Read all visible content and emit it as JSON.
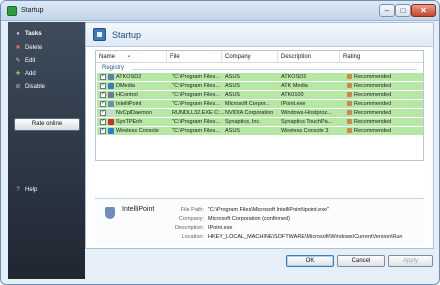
{
  "window": {
    "title": "Startup"
  },
  "sidebar": {
    "items": [
      {
        "label": "Tasks",
        "icon": "bullet-icon"
      },
      {
        "label": "Delete",
        "icon": "delete-icon"
      },
      {
        "label": "Edit",
        "icon": "edit-icon"
      },
      {
        "label": "Add",
        "icon": "add-icon"
      },
      {
        "label": "Disable",
        "icon": "disable-icon"
      }
    ],
    "rate_button": "Rate online",
    "help": "Help"
  },
  "main": {
    "title": "Startup",
    "columns": [
      "Name",
      "File",
      "Company",
      "Description",
      "Rating"
    ],
    "group": "Registry",
    "rows": [
      {
        "name": "ATKOSD2",
        "file": "\"C:\\Program Files...",
        "company": "ASUS",
        "description": "ATKOSD2",
        "rating": "Recommended",
        "color": "#5c7ea6"
      },
      {
        "name": "DMedia",
        "file": "\"C:\\Program Files...",
        "company": "ASUS",
        "description": "ATK Media",
        "rating": "Recommended",
        "color": "#3f7ab8"
      },
      {
        "name": "HControl",
        "file": "\"C:\\Program Files...",
        "company": "ASUS",
        "description": "ATK0100",
        "rating": "Recommended",
        "color": "#6a7c90"
      },
      {
        "name": "IntelliPoint",
        "file": "\"C:\\Program Files...",
        "company": "Microsoft Corpor...",
        "description": "IPoint.exe",
        "rating": "Recommended",
        "color": "#6b8fb8"
      },
      {
        "name": "NvCplDaemon",
        "file": "RUNDLL32.EXE C:...",
        "company": "NVIDIA Corporation",
        "description": "Windows-Hostproz...",
        "rating": "Recommended",
        "color": "#d0d4d8"
      },
      {
        "name": "SynTPEnh",
        "file": "\"C:\\Program Files...",
        "company": "Synaptics, Inc.",
        "description": "Synaptics TouchPa...",
        "rating": "Recommended",
        "color": "#c9302c"
      },
      {
        "name": "Wireless Console",
        "file": "\"C:\\Program Files...",
        "company": "ASUS",
        "description": "Wireless Console 3",
        "rating": "Recommended",
        "color": "#2a7fd0"
      }
    ]
  },
  "details": {
    "name": "IntelliPoint",
    "fields": [
      {
        "label": "File Path:",
        "value": "\"C:\\Program Files\\Microsoft IntelliPoint\\ipoint.exe\""
      },
      {
        "label": "Company:",
        "value": "Microsoft Corporation (confirmed)"
      },
      {
        "label": "Description:",
        "value": "IPoint.exe"
      },
      {
        "label": "Location:",
        "value": "HKEY_LOCAL_MACHINE\\SOFTWARE\\Microsoft\\Windows\\CurrentVersion\\Run"
      }
    ]
  },
  "buttons": {
    "ok": "OK",
    "cancel": "Cancel",
    "apply": "Apply"
  },
  "colors": {
    "recommended_row": "#b6e7a4",
    "sidebar": "#2c3744",
    "accent": "#1c4a86"
  }
}
